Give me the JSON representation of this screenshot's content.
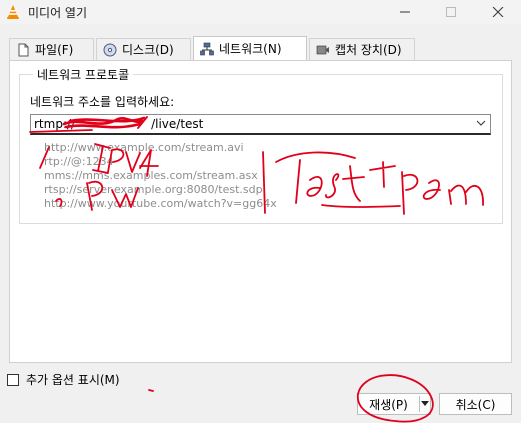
{
  "window": {
    "title": "미디어 열기",
    "icon": "vlc-cone-icon",
    "controls": [
      "minimize-icon",
      "maximize-icon",
      "close-icon"
    ]
  },
  "tabs": [
    {
      "label": "파일(F)",
      "icon": "file-icon",
      "active": false
    },
    {
      "label": "디스크(D)",
      "icon": "disc-icon",
      "active": false
    },
    {
      "label": "네트워크(N)",
      "icon": "network-icon",
      "active": true
    },
    {
      "label": "캡처 장치(D)",
      "icon": "capture-device-icon",
      "active": false
    }
  ],
  "network": {
    "group_title": "네트워크 프로토콜",
    "url_label": "네트워크 주소를 입력하세요:",
    "url_value": "rtmp://",
    "url_value_tail": "/live/test",
    "examples": [
      "http://www.example.com/stream.avi",
      "rtp://@:1234",
      "mms://mms.examples.com/stream.asx",
      "rtsp://server.example.org:8080/test.sdp",
      "http://www.yourtube.com/watch?v=gg64x"
    ]
  },
  "footer": {
    "more_options_label": "추가 옵션 표시(M)",
    "more_options_checked": false,
    "play_label": "재생(P)",
    "cancel_label": "취소(C)"
  },
  "annotations": {
    "ink_color": "#e0001a",
    "handwritten": [
      "IPV4",
      "Pw",
      "test pem"
    ]
  }
}
